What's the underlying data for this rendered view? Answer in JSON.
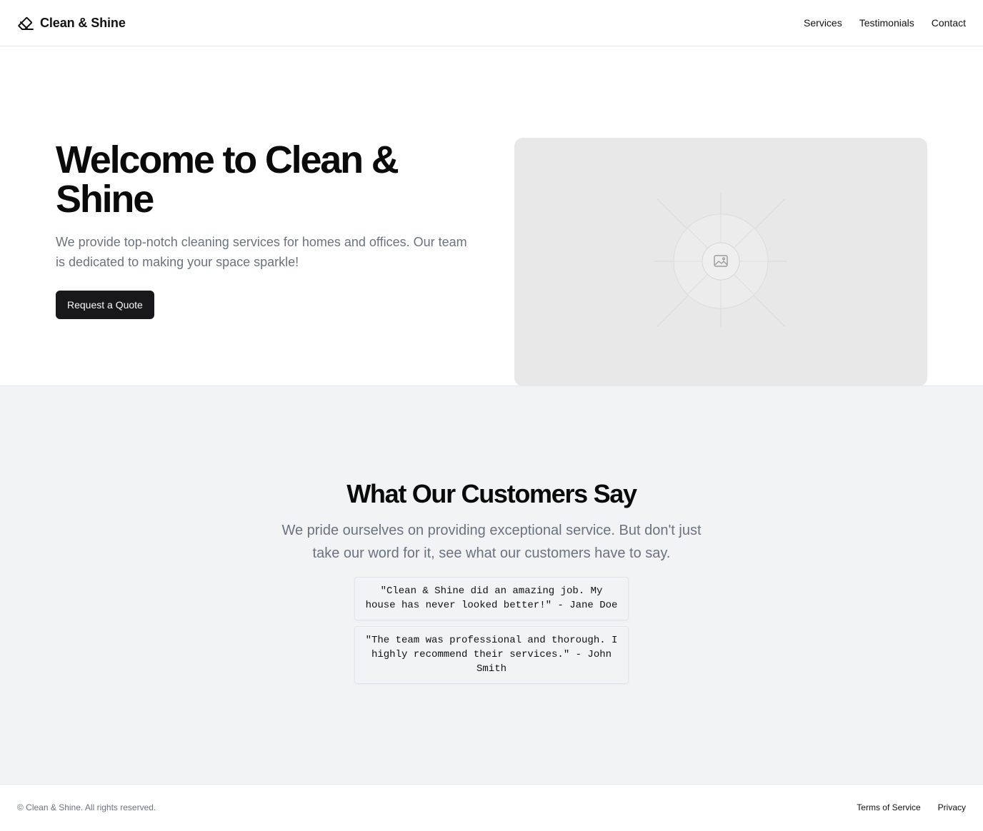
{
  "header": {
    "brand_name": "Clean & Shine",
    "brand_icon": "eraser-icon",
    "nav": [
      {
        "label": "Services"
      },
      {
        "label": "Testimonials"
      },
      {
        "label": "Contact"
      }
    ]
  },
  "hero": {
    "title": "Welcome to Clean & Shine",
    "subtitle": "We provide top-notch cleaning services for homes and offices. Our team is dedicated to making your space sparkle!",
    "cta_label": "Request a Quote",
    "image_icon": "image-placeholder-icon"
  },
  "testimonials": {
    "title": "What Our Customers Say",
    "subtitle": "We pride ourselves on providing exceptional service. But don't just take our word for it, see what our customers have to say.",
    "items": [
      {
        "quote": "\"Clean & Shine did an amazing job. My house has never looked better!\" - Jane Doe"
      },
      {
        "quote": "\"The team was professional and thorough. I highly recommend their services.\" - John Smith"
      }
    ]
  },
  "footer": {
    "copyright": "© Clean & Shine. All rights reserved.",
    "links": [
      {
        "label": "Terms of Service"
      },
      {
        "label": "Privacy"
      }
    ]
  },
  "colors": {
    "accent_button": "#18181b",
    "muted_text": "#6b7280",
    "section_bg": "#f2f3f4",
    "placeholder_bg": "#e8e8e8"
  }
}
